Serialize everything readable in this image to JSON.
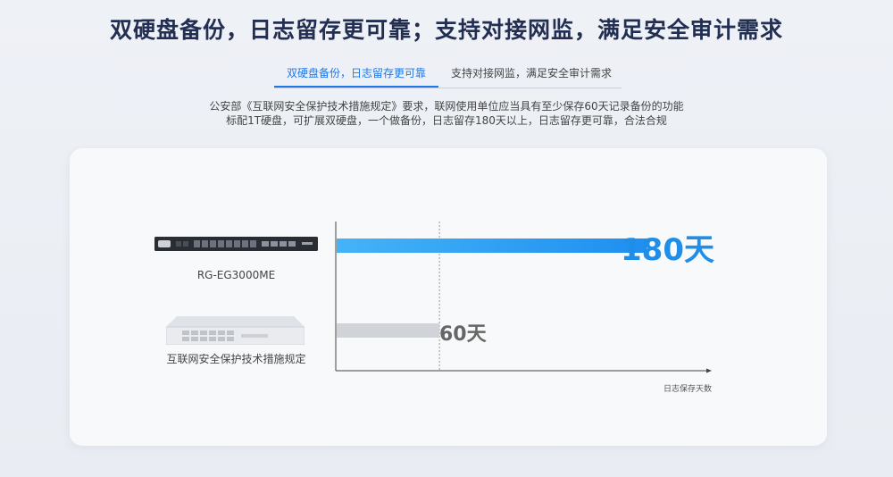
{
  "header": {
    "title": "双硬盘备份，日志留存更可靠；支持对接网监，满足安全审计需求"
  },
  "tabs": [
    {
      "label": "双硬盘备份，日志留存更可靠",
      "active": true
    },
    {
      "label": "支持对接网监，满足安全审计需求",
      "active": false
    }
  ],
  "description": {
    "line1": "公安部《互联网安全保护技术措施规定》要求，联网使用单位应当具有至少保存60天记录备份的功能",
    "line2": "标配1T硬盘，可扩展双硬盘，一个做备份，日志留存180天以上，日志留存更可靠，合法合规"
  },
  "devices": [
    {
      "label": "RG-EG3000ME"
    },
    {
      "label": "互联网安全保护技术措施规定"
    }
  ],
  "chart_data": {
    "type": "bar",
    "orientation": "horizontal",
    "categories": [
      "RG-EG3000ME",
      "互联网安全保护技术措施规定"
    ],
    "values": [
      180,
      60
    ],
    "value_labels": [
      "180天",
      "60天"
    ],
    "xlabel": "日志保存天数",
    "xlim": [
      0,
      216
    ],
    "reference_line": 60,
    "colors": [
      "#1e8ff0",
      "#d0d3d8"
    ]
  }
}
